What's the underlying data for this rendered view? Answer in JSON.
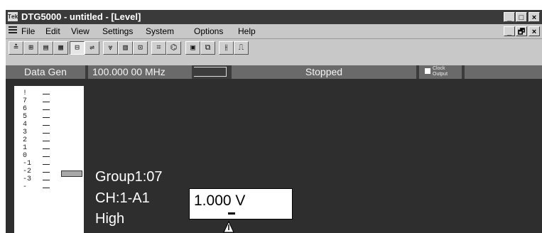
{
  "window": {
    "title": "DTG5000 - untitled - [Level]",
    "app_icon": "Tek",
    "controls": [
      "_",
      "□",
      "×"
    ],
    "doc_controls": [
      "_",
      "🗗",
      "×"
    ]
  },
  "menu": {
    "items": [
      "File",
      "Edit",
      "View",
      "Settings",
      "System",
      "Options",
      "Help"
    ]
  },
  "toolbar": {
    "buttons": [
      {
        "icon": "data-gen-icon",
        "glyph": "≛"
      },
      {
        "icon": "setup-icon",
        "glyph": "⊞"
      },
      {
        "icon": "listing-icon",
        "glyph": "▤"
      },
      {
        "icon": "grid-icon",
        "glyph": "▦"
      },
      {
        "icon": "level-icon",
        "glyph": "⊟"
      },
      {
        "icon": "timing-icon",
        "glyph": "⇌"
      },
      {
        "icon": "pattern-icon",
        "glyph": "⩔"
      },
      {
        "icon": "block-icon",
        "glyph": "▥"
      },
      {
        "icon": "sequence-icon",
        "glyph": "⊡"
      },
      {
        "icon": "editor-icon",
        "glyph": "⌗"
      },
      {
        "icon": "probe-icon",
        "glyph": "⌬"
      },
      {
        "icon": "run-icon",
        "glyph": "▣"
      },
      {
        "icon": "stop-icon",
        "glyph": "⧉"
      },
      {
        "icon": "channel-icon",
        "glyph": "⫲"
      },
      {
        "icon": "waveform-icon",
        "glyph": "⎍"
      }
    ]
  },
  "status": {
    "mode": "Data Gen",
    "frequency": "100.000 00 MHz",
    "run_state": "Stopped",
    "clock_label": "Clock Output"
  },
  "level": {
    "scale": [
      "!",
      "7",
      "6",
      "5",
      "4",
      "3",
      "2",
      "1",
      "0",
      "-1",
      "-2",
      "-3",
      "-"
    ],
    "group": "Group1:07",
    "channel": "CH:1-A1",
    "state": "High",
    "value": "1.000 V"
  },
  "colors": {
    "titlebar": "#3a3a3a",
    "chrome": "#c8c8c8",
    "panel": "#2e2e2e",
    "status_field": "#6a6a6a"
  }
}
